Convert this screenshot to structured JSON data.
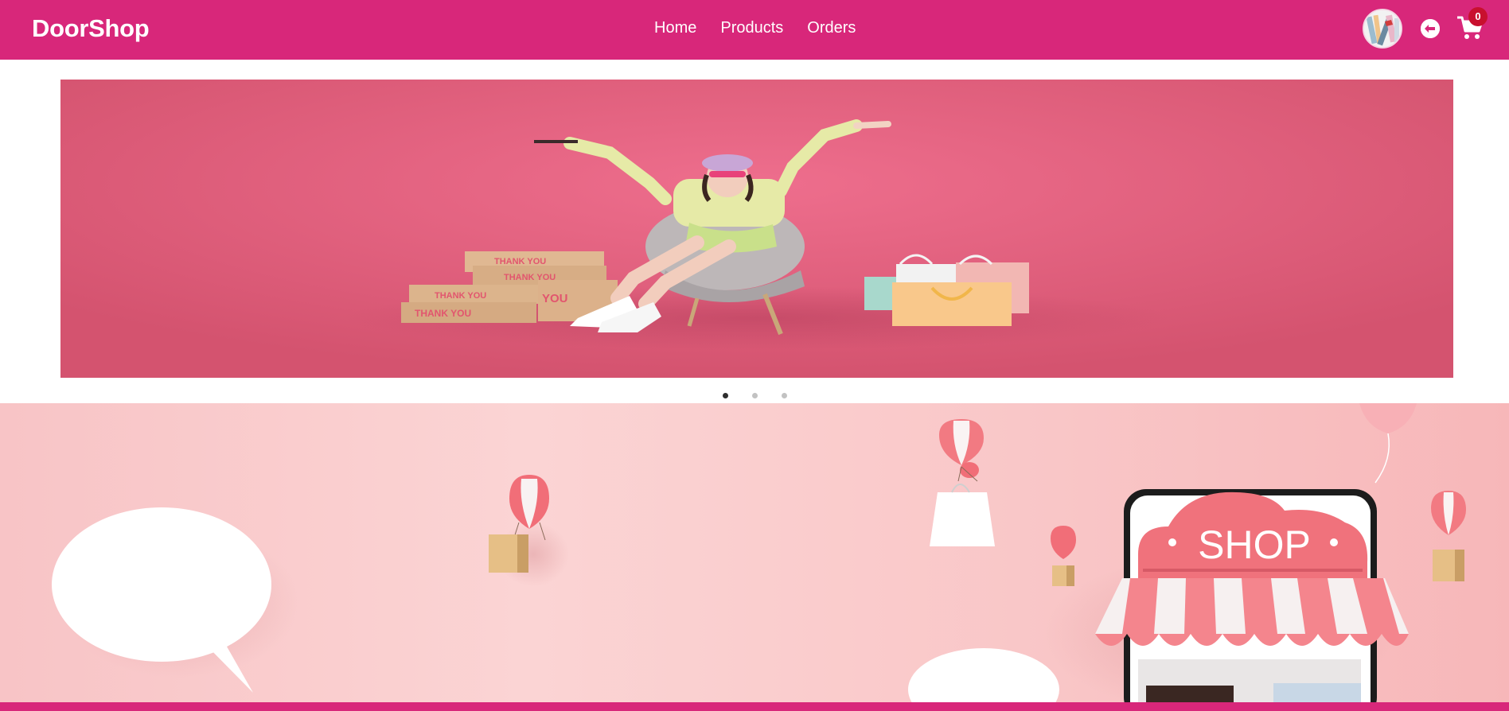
{
  "brand": {
    "name": "DoorShop"
  },
  "nav": {
    "links": [
      {
        "label": "Home"
      },
      {
        "label": "Products"
      },
      {
        "label": "Orders"
      }
    ]
  },
  "cart": {
    "count": "0"
  },
  "hero": {
    "box_text": "THANK YOU",
    "box_partial_text": "YOU"
  },
  "carousel": {
    "slide_count": 3,
    "active_index": 0
  },
  "banner": {
    "shop_sign": "SHOP"
  },
  "colors": {
    "brand": "#d8277a",
    "badge": "#c8102e",
    "hero_bg": "#e05a7c",
    "banner_bg": "#f8c9cb"
  },
  "icons": [
    "user-avatar",
    "logout-icon",
    "cart-icon",
    "balloon-icon",
    "shopping-bag-icon",
    "speech-bubble-icon"
  ]
}
